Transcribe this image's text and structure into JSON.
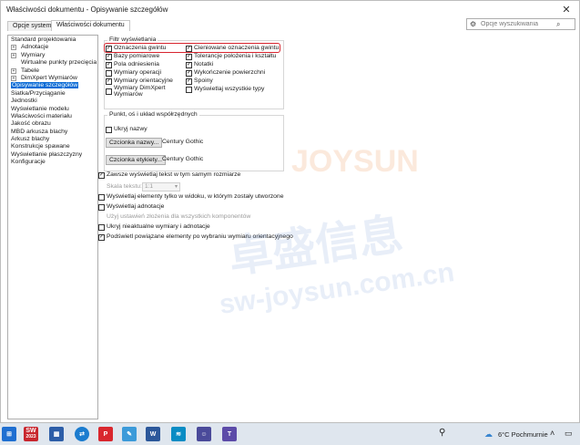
{
  "window": {
    "title": "Właściwości dokumentu - Opisywanie szczegółów",
    "close": "✕"
  },
  "tabs": [
    {
      "label": "Opcje systemu",
      "active": false
    },
    {
      "label": "Właściwości dokumentu",
      "active": true
    }
  ],
  "search": {
    "placeholder": "Opcje wyszukiwania"
  },
  "tree": [
    {
      "label": "Standard projektowania",
      "level": 0,
      "expander": false
    },
    {
      "label": "Adnotacje",
      "level": 1,
      "expander": true
    },
    {
      "label": "Wymiary",
      "level": 1,
      "expander": true
    },
    {
      "label": "Wirtualne punkty przecięcia",
      "level": 1,
      "expander": false
    },
    {
      "label": "Tabele",
      "level": 1,
      "expander": true
    },
    {
      "label": "DimXpert Wymiarów",
      "level": 1,
      "expander": true
    },
    {
      "label": "Opisywanie szczegółów",
      "level": 0,
      "expander": false,
      "selected": true
    },
    {
      "label": "Siatka/Przyciąganie",
      "level": 0,
      "expander": false
    },
    {
      "label": "Jednostki",
      "level": 0,
      "expander": false
    },
    {
      "label": "Wyświetlanie modelu",
      "level": 0,
      "expander": false
    },
    {
      "label": "Właściwości materiału",
      "level": 0,
      "expander": false
    },
    {
      "label": "Jakość obrazu",
      "level": 0,
      "expander": false
    },
    {
      "label": "MBD arkusza blachy",
      "level": 0,
      "expander": false
    },
    {
      "label": "Arkusz blachy",
      "level": 0,
      "expander": false
    },
    {
      "label": "Konstrukcje spawane",
      "level": 0,
      "expander": false
    },
    {
      "label": "Wyświetlanie płaszczyzny",
      "level": 0,
      "expander": false
    },
    {
      "label": "Konfiguracje",
      "level": 0,
      "expander": false
    }
  ],
  "filter": {
    "title": "Filtr wyświetlania",
    "left": [
      {
        "label": "Oznaczenia gwintu",
        "checked": true
      },
      {
        "label": "Bazy pomiarowe",
        "checked": true
      },
      {
        "label": "Pola odniesienia",
        "checked": true
      },
      {
        "label": "Wymiary operacji",
        "checked": false
      },
      {
        "label": "Wymiary orientacyjne",
        "checked": true
      },
      {
        "label": "Wymiary DimXpert",
        "checked": false,
        "label2": "Wymiarów"
      }
    ],
    "right": [
      {
        "label": "Cieniowane oznaczenia gwintu",
        "checked": true
      },
      {
        "label": "Tolerancje położenia i kształtu",
        "checked": true
      },
      {
        "label": "Notatki",
        "checked": true
      },
      {
        "label": "Wykończenie powierzchni",
        "checked": true
      },
      {
        "label": "Spoiny",
        "checked": true
      },
      {
        "label": "Wyświetlaj wszystkie typy",
        "checked": false
      }
    ]
  },
  "points": {
    "title": "Punkt, oś i układ współrzędnych",
    "hide_names": {
      "label": "Ukryj nazwy",
      "checked": false
    },
    "font_name_button": "Czcionka nazwy...",
    "font_name_value": "Century Gothic",
    "font_label_button": "Czcionka etykiety...",
    "font_label_value": "Century Gothic"
  },
  "options": {
    "same_size": {
      "label": "Zawsze wyświetlaj tekst w tym samym rozmiarze",
      "checked": true
    },
    "scale_label": "Skala tekstu:",
    "scale_value": "1:1",
    "only_in_view": {
      "label": "Wyświetlaj elementy tylko w widoku, w którym zostały utworzone",
      "checked": false
    },
    "show_annotations": {
      "label": "Wyświetlaj adnotacje",
      "checked": false
    },
    "use_assembly": {
      "label": "Użyj ustawień złożenia dla wszystkich komponentów",
      "checked": false
    },
    "hide_dangling": {
      "label": "Ukryj nieaktualne wymiary i adnotacje",
      "checked": false
    },
    "highlight_associated": {
      "label": "Podświetl powiązane elementy po wybraniu wymiaru orientacyjnego",
      "checked": true
    }
  },
  "watermark": {
    "line1": "JOYSUN",
    "line2": "卓盛信息",
    "line3": "sw-joysun.com.cn"
  },
  "taskbar": {
    "weather": "6°C  Pochmurnie",
    "badge_label": "SW",
    "badge_year": "2023"
  },
  "colors": {
    "accent": "#0b6cd6",
    "highlight_border": "#d8252f",
    "taskbar": "#dfe6ee"
  }
}
